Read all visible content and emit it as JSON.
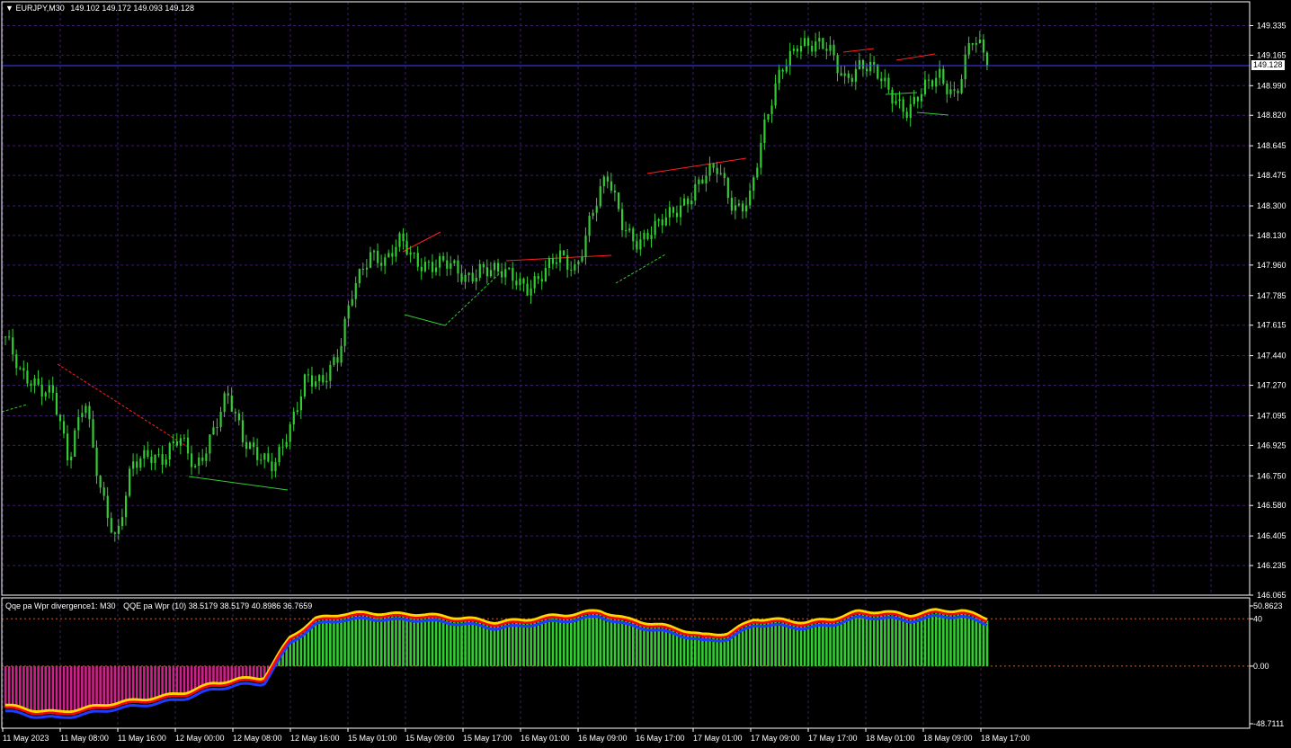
{
  "main": {
    "symbol_label": "EURJPY,M30",
    "ohlc": "149.102 149.172 149.093 149.128",
    "price_tag": "149.128",
    "y_ticks": [
      "149.335",
      "149.165",
      "148.990",
      "148.820",
      "148.645",
      "148.475",
      "148.300",
      "148.130",
      "147.960",
      "147.785",
      "147.615",
      "147.440",
      "147.270",
      "147.095",
      "146.925",
      "146.750",
      "146.580",
      "146.405",
      "146.235",
      "146.065"
    ]
  },
  "sub": {
    "label": "Qqe pa Wpr divergence1: M30",
    "values_label": "QQE pa Wpr (10) 38.5179 38.5179 40.8986 36.7659",
    "y_ticks": [
      "50.8623",
      "40",
      "0.00",
      "-48.7111"
    ]
  },
  "x_axis": [
    "11 May 2023",
    "11 May 08:00",
    "11 May 16:00",
    "12 May 00:00",
    "12 May 08:00",
    "12 May 16:00",
    "15 May 01:00",
    "15 May 09:00",
    "15 May 17:00",
    "16 May 01:00",
    "16 May 09:00",
    "16 May 17:00",
    "17 May 01:00",
    "17 May 09:00",
    "17 May 17:00",
    "18 May 01:00",
    "18 May 09:00",
    "18 May 17:00"
  ],
  "colors": {
    "background": "#000000",
    "grid": "#3a1f63",
    "candle": "#33cc33",
    "bear_div": "#ff2020",
    "bull_div": "#33cc33",
    "hist_pos": "#33cc33",
    "hist_neg": "#cc2288",
    "line_red": "#ff0000",
    "line_yellow": "#ffd700",
    "line_blue": "#1e3cff",
    "price_line": "#4040ff"
  },
  "chart_data": [
    {
      "type": "candlestick",
      "title": "EURJPY,M30",
      "ylim": [
        146.065,
        149.42
      ],
      "last_price": 149.128,
      "x": [
        "11 May 2023",
        "11 May 08:00",
        "11 May 16:00",
        "12 May 00:00",
        "12 May 08:00",
        "12 May 16:00",
        "15 May 01:00",
        "15 May 09:00",
        "15 May 17:00",
        "16 May 01:00",
        "16 May 09:00",
        "16 May 17:00",
        "17 May 01:00",
        "17 May 09:00",
        "17 May 17:00",
        "18 May 01:00",
        "18 May 09:00",
        "18 May 17:00"
      ],
      "close_path": [
        [
          0,
          147.55
        ],
        [
          1,
          147.3
        ],
        [
          2,
          147.28
        ],
        [
          3,
          147.25
        ],
        [
          4,
          146.8
        ],
        [
          5,
          147.2
        ],
        [
          6,
          146.7
        ],
        [
          7,
          146.35
        ],
        [
          8,
          146.8
        ],
        [
          9,
          146.9
        ],
        [
          10,
          146.85
        ],
        [
          11,
          146.95
        ],
        [
          12,
          146.8
        ],
        [
          13,
          147.0
        ],
        [
          14,
          147.2
        ],
        [
          15,
          146.95
        ],
        [
          16,
          146.9
        ],
        [
          17,
          146.8
        ],
        [
          18,
          147.0
        ],
        [
          19,
          147.35
        ],
        [
          20,
          147.3
        ],
        [
          21,
          147.4
        ],
        [
          22,
          147.85
        ],
        [
          23,
          148.05
        ],
        [
          24,
          147.95
        ],
        [
          25,
          148.1
        ],
        [
          26,
          148.0
        ],
        [
          27,
          147.95
        ],
        [
          28,
          147.95
        ],
        [
          29,
          147.9
        ],
        [
          30,
          147.95
        ],
        [
          31,
          147.9
        ],
        [
          32,
          147.9
        ],
        [
          33,
          147.85
        ],
        [
          34,
          147.9
        ],
        [
          35,
          148.0
        ],
        [
          36,
          147.95
        ],
        [
          37,
          148.25
        ],
        [
          38,
          148.45
        ],
        [
          39,
          148.2
        ],
        [
          40,
          148.1
        ],
        [
          41,
          148.15
        ],
        [
          42,
          148.25
        ],
        [
          43,
          148.35
        ],
        [
          44,
          148.45
        ],
        [
          45,
          148.5
        ],
        [
          46,
          148.3
        ],
        [
          47,
          148.35
        ],
        [
          48,
          148.75
        ],
        [
          49,
          149.1
        ],
        [
          50,
          149.25
        ],
        [
          51,
          149.2
        ],
        [
          52,
          149.2
        ],
        [
          53,
          149.05
        ],
        [
          54,
          149.1
        ],
        [
          55,
          149.05
        ],
        [
          56,
          148.95
        ],
        [
          57,
          148.85
        ],
        [
          58,
          148.95
        ],
        [
          59,
          149.05
        ],
        [
          60,
          148.95
        ],
        [
          61,
          149.25
        ],
        [
          62,
          149.13
        ]
      ]
    },
    {
      "type": "line",
      "title": "QQE pa Wpr (10)",
      "ylim": [
        -48.7111,
        50.8623
      ],
      "levels": [
        40,
        0
      ],
      "series": [
        {
          "name": "QQE pa Wpr (10)",
          "values": [
            -35,
            -39,
            -41,
            -38,
            -34,
            -31,
            -28,
            -24,
            -17,
            -13,
            -12,
            22,
            38,
            42,
            43,
            42,
            42,
            40,
            38,
            35,
            37,
            40,
            42,
            45,
            38,
            34,
            30,
            24,
            26,
            38,
            37,
            35,
            38,
            44,
            44,
            41,
            45,
            45,
            38.52
          ]
        }
      ]
    }
  ]
}
